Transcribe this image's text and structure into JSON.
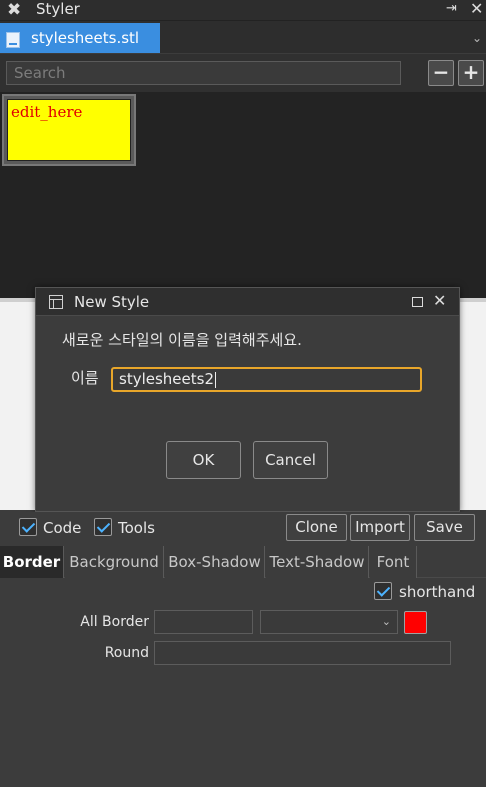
{
  "window": {
    "title": "Styler",
    "tool_icon": "tools-icon",
    "pin_icon": "dock-icon",
    "close_glyph": "✕"
  },
  "file_tab": {
    "label": "stylesheets.stl",
    "icon": "stylesheet-file-icon",
    "dropdown_glyph": "⌄"
  },
  "search": {
    "placeholder": "Search",
    "value": ""
  },
  "toolbar": {
    "remove_label": "−",
    "add_label": "+"
  },
  "style_items": [
    {
      "label": "edit_here",
      "background": "#ffff00",
      "text_color": "#e00000"
    }
  ],
  "dialog": {
    "title": "New Style",
    "prompt": "새로운 스타일의 이름을 입력해주세요.",
    "name_label": "이름",
    "name_value": "stylesheets2",
    "ok_label": "OK",
    "cancel_label": "Cancel",
    "close_glyph": "✕"
  },
  "options": {
    "code": {
      "label": "Code",
      "checked": true
    },
    "tools": {
      "label": "Tools",
      "checked": true
    },
    "clone_label": "Clone",
    "import_label": "Import",
    "save_label": "Save"
  },
  "property_tabs": [
    {
      "label": "Border",
      "active": true
    },
    {
      "label": "Background",
      "active": false
    },
    {
      "label": "Box-Shadow",
      "active": false
    },
    {
      "label": "Text-Shadow",
      "active": false
    },
    {
      "label": "Font",
      "active": false
    }
  ],
  "border_panel": {
    "shorthand": {
      "label": "shorthand",
      "checked": true
    },
    "all_border_label": "All Border",
    "all_border_width": "",
    "all_border_style": "",
    "all_border_color": "#ff0000",
    "round_label": "Round",
    "round_value": ""
  },
  "colors": {
    "accent": "#3a8ee0",
    "focus": "#e8a62a",
    "check": "#4db3ff"
  }
}
